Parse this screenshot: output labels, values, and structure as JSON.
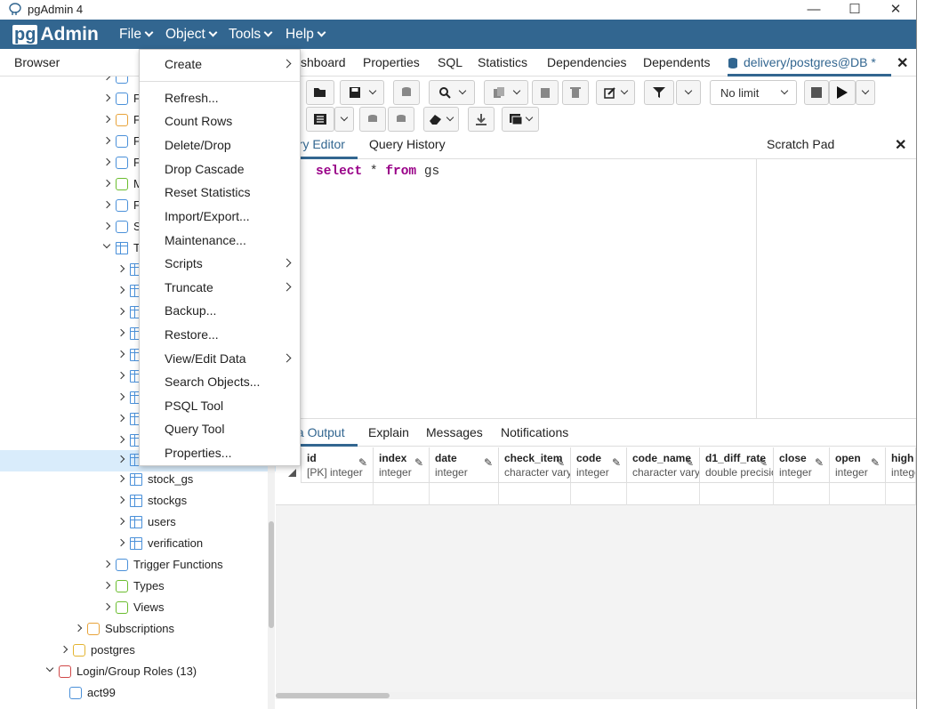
{
  "window": {
    "title": "pgAdmin 4",
    "controls": {
      "minimize": "—",
      "maximize": "☐",
      "close": "✕"
    }
  },
  "menubar": {
    "logo_pg": "pg",
    "logo_admin": "Admin",
    "items": [
      "File",
      "Object",
      "Tools",
      "Help"
    ],
    "color": "#326690"
  },
  "browser": {
    "title": "Browser",
    "tree": [
      {
        "label": "",
        "icon": "foreign-table-icon",
        "expanded": false
      },
      {
        "label": "F",
        "icon": "fts-configuration-icon",
        "expanded": false
      },
      {
        "label": "F",
        "icon": "fts-dictionary-icon",
        "expanded": false
      },
      {
        "label": "F",
        "icon": "fts-parser-icon",
        "expanded": false
      },
      {
        "label": "F",
        "icon": "fts-template-icon",
        "expanded": false
      },
      {
        "label": "M",
        "icon": "materialized-view-icon",
        "expanded": false
      },
      {
        "label": "F",
        "icon": "function-icon",
        "expanded": false
      },
      {
        "label": "S",
        "icon": "sequence-icon",
        "expanded": false
      },
      {
        "label": "T",
        "icon": "tables-icon",
        "expanded": true
      },
      {
        "label": "",
        "icon": "table-icon",
        "expanded": false
      },
      {
        "label": "",
        "icon": "table-icon",
        "expanded": false
      },
      {
        "label": "",
        "icon": "table-icon",
        "expanded": false
      },
      {
        "label": "",
        "icon": "table-icon",
        "expanded": false
      },
      {
        "label": "",
        "icon": "table-icon",
        "expanded": false
      },
      {
        "label": "",
        "icon": "table-icon",
        "expanded": false
      },
      {
        "label": "",
        "icon": "table-icon",
        "expanded": false
      },
      {
        "label": "",
        "icon": "table-icon",
        "expanded": false
      },
      {
        "label": "",
        "icon": "table-icon",
        "expanded": false
      },
      {
        "label": "",
        "icon": "table-icon",
        "expanded": false
      },
      {
        "label": "stock_gs",
        "icon": "table-icon",
        "expanded": false
      },
      {
        "label": "stockgs",
        "icon": "table-icon",
        "expanded": false
      },
      {
        "label": "users",
        "icon": "table-icon",
        "expanded": false
      },
      {
        "label": "verification",
        "icon": "table-icon",
        "expanded": false
      },
      {
        "label": "Trigger Functions",
        "icon": "trigger-function-icon",
        "expanded": false
      },
      {
        "label": "Types",
        "icon": "type-icon",
        "expanded": false
      },
      {
        "label": "Views",
        "icon": "view-icon",
        "expanded": false
      },
      {
        "label": "Subscriptions",
        "icon": "subscription-icon",
        "expanded": false
      },
      {
        "label": "postgres",
        "icon": "database-icon",
        "expanded": false
      },
      {
        "label": "Login/Group Roles (13)",
        "icon": "login-roles-icon",
        "expanded": true
      },
      {
        "label": "act99",
        "icon": "user-icon",
        "expanded": false
      }
    ],
    "selected_index": 18
  },
  "tabs": {
    "items": [
      "shboard",
      "Properties",
      "SQL",
      "Statistics",
      "Dependencies",
      "Dependents"
    ],
    "active": "delivery/postgres@DB *",
    "close": "✕"
  },
  "toolbar": {
    "limit": "No limit"
  },
  "editor": {
    "tabs": [
      "ery Editor",
      "Query History"
    ],
    "sql": {
      "k1": "select",
      "star": " * ",
      "k2": "from",
      "table": " gs"
    }
  },
  "scratch": {
    "title": "Scratch Pad",
    "close": "✕"
  },
  "output": {
    "tabs": [
      "ta Output",
      "Explain",
      "Messages",
      "Notifications"
    ],
    "columns": [
      {
        "name": "id",
        "type": "[PK] integer"
      },
      {
        "name": "index",
        "type": "integer"
      },
      {
        "name": "date",
        "type": "integer"
      },
      {
        "name": "check_item",
        "type": "character varying"
      },
      {
        "name": "code",
        "type": "integer"
      },
      {
        "name": "code_name",
        "type": "character varying"
      },
      {
        "name": "d1_diff_rate",
        "type": "double precision"
      },
      {
        "name": "close",
        "type": "integer"
      },
      {
        "name": "open",
        "type": "integer"
      },
      {
        "name": "high",
        "type": "integer"
      }
    ]
  },
  "context_menu": {
    "items": [
      {
        "label": "Create",
        "submenu": true
      },
      {
        "label": "Refresh...",
        "submenu": false
      },
      {
        "label": "Count Rows",
        "submenu": false
      },
      {
        "label": "Delete/Drop",
        "submenu": false
      },
      {
        "label": "Drop Cascade",
        "submenu": false
      },
      {
        "label": "Reset Statistics",
        "submenu": false
      },
      {
        "label": "Import/Export...",
        "submenu": false
      },
      {
        "label": "Maintenance...",
        "submenu": false
      },
      {
        "label": "Scripts",
        "submenu": true
      },
      {
        "label": "Truncate",
        "submenu": true
      },
      {
        "label": "Backup...",
        "submenu": false
      },
      {
        "label": "Restore...",
        "submenu": false
      },
      {
        "label": "View/Edit Data",
        "submenu": true
      },
      {
        "label": "Search Objects...",
        "submenu": false
      },
      {
        "label": "PSQL Tool",
        "submenu": false
      },
      {
        "label": "Query Tool",
        "submenu": false
      },
      {
        "label": "Properties...",
        "submenu": false
      }
    ]
  }
}
